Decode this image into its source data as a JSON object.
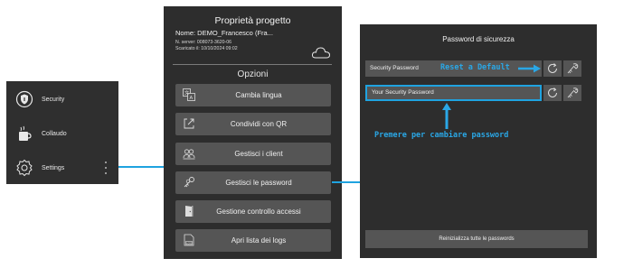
{
  "left_menu": {
    "items": [
      {
        "label": "Security",
        "icon": "shield-icon"
      },
      {
        "label": "Collaudo",
        "icon": "coffee-cup-icon"
      },
      {
        "label": "Settings",
        "icon": "gear-icon"
      }
    ]
  },
  "project_panel": {
    "title": "Proprietà progetto",
    "name_line": "Nome: DEMO_Francesco (Fra...",
    "server_line": "N. server: 008073-3620-06",
    "download_line": "Scaricato il: 10/10/2024 09:02",
    "options_title": "Opzioni",
    "buttons": [
      {
        "label": "Cambia lingua",
        "icon": "language-icon"
      },
      {
        "label": "Condividi con QR",
        "icon": "share-icon"
      },
      {
        "label": "Gestisci i client",
        "icon": "clients-icon"
      },
      {
        "label": "Gestisci le password",
        "icon": "keys-icon"
      },
      {
        "label": "Gestione controllo accessi",
        "icon": "door-icon"
      },
      {
        "label": "Apri lista dei logs",
        "icon": "log-file-icon"
      }
    ]
  },
  "password_panel": {
    "title": "Password di sicurezza",
    "rows": [
      {
        "label": "Security Password"
      },
      {
        "label": "Your Security Password"
      }
    ],
    "reset_all_label": "Reinizializza tutte le passwords"
  },
  "annotations": {
    "reset_default": "Reset a Default",
    "change_password": "Premere per cambiare password"
  },
  "colors": {
    "accent": "#1fa3e0",
    "panel_bg": "#2d2d2d",
    "button_bg": "#555555"
  }
}
